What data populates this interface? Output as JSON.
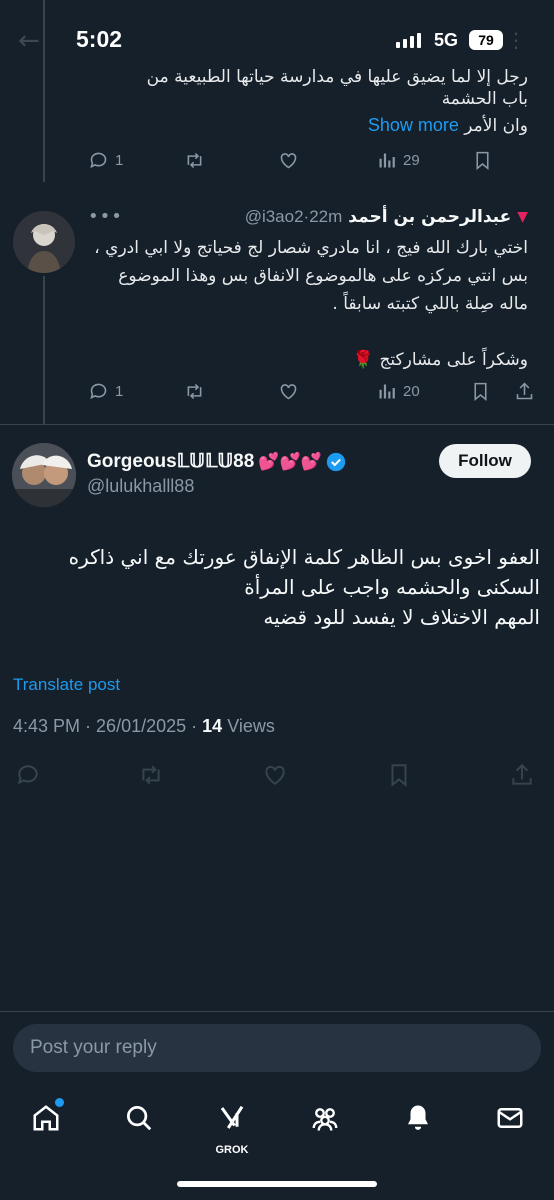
{
  "status_bar": {
    "time": "5:02",
    "network": "5G",
    "battery": "79"
  },
  "thread_tail": {
    "text_lines": [
      "رجل إلا لما يضيق عليها في مدارسة حياتها الطبيعية من",
      "باب الحشمة",
      "وان الأمر"
    ],
    "show_more": "Show more",
    "actions": {
      "replies": "1",
      "views": "29"
    }
  },
  "reply_post": {
    "name": "عبدالرحمن بن أحمد",
    "handle": "@i3ao2",
    "time": "22m",
    "badge_icon": "red-triangle-icon",
    "paragraphs": [
      "اختي بارك الله فيج ، انا مادري شصار لج فحياتج ولا ابي ادري ، بس انتي مركزه على هالموضوع الانفاق بس وهذا الموضوع ماله صِلة باللي كتبته سابقاً .",
      "وشكراً على مشاركتج 🌹"
    ],
    "actions": {
      "replies": "1",
      "likes": "",
      "views": "20"
    }
  },
  "main_post": {
    "display_name": "Gorgeous𝕃𝕌𝕃𝕌88",
    "name_emoji": "💕💕💕",
    "handle": "@lulukhalll88",
    "follow_label": "Follow",
    "text_lines": [
      "العفو اخوى بس الظاهر  كلمة الإنفاق عورتك مع اني ذاكره",
      "السكنى والحشمه واجب على المرأة",
      "المهم الاختلاف لا يفسد للود قضيه"
    ],
    "translate": "Translate post",
    "time": "4:43 PM",
    "date": "26/01/2025",
    "views_count": "14",
    "views_label": "Views"
  },
  "composer": {
    "placeholder": "Post your reply"
  },
  "nav": {
    "grok_label": "GROK"
  },
  "colors": {
    "accent": "#1d9bf0",
    "background": "#15202b",
    "muted": "#8b98a5"
  }
}
